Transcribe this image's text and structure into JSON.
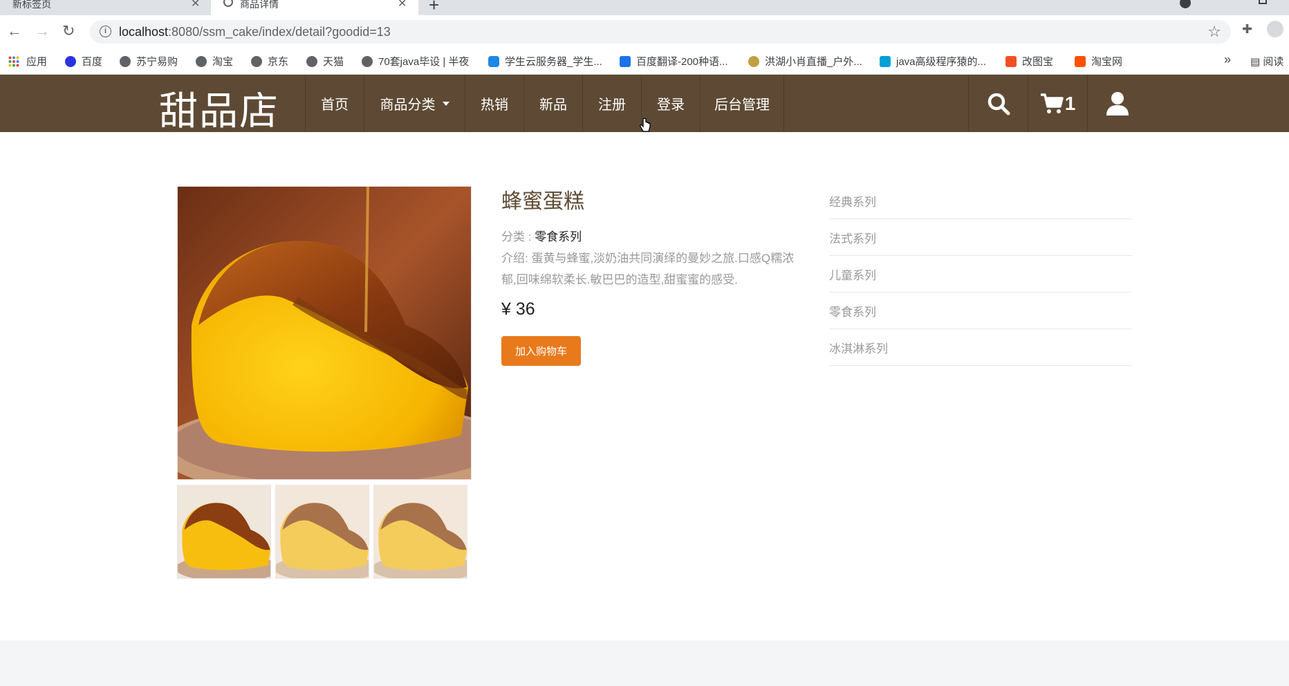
{
  "browser": {
    "tabs": [
      {
        "title": "新标签页",
        "active": false
      },
      {
        "title": "商品详情",
        "active": true
      }
    ],
    "url_host": "localhost",
    "url_rest": ":8080/ssm_cake/index/detail?goodid=13",
    "bookmarks": [
      {
        "label": "应用",
        "icon": "apps-icon"
      },
      {
        "label": "百度",
        "icon": "baidu-icon"
      },
      {
        "label": "苏宁易购",
        "icon": "globe-icon"
      },
      {
        "label": "淘宝",
        "icon": "globe-icon"
      },
      {
        "label": "京东",
        "icon": "globe-icon"
      },
      {
        "label": "天猫",
        "icon": "globe-icon"
      },
      {
        "label": "70套java毕设 | 半夜",
        "icon": "globe-icon"
      },
      {
        "label": "学生云服务器_学生...",
        "icon": "cloud-icon"
      },
      {
        "label": "百度翻译-200种语...",
        "icon": "translate-icon"
      },
      {
        "label": "洪湖小肖直播_户外...",
        "icon": "bird-icon"
      },
      {
        "label": "java高级程序猿的...",
        "icon": "bilibili-icon"
      },
      {
        "label": "改图宝",
        "icon": "gaitubao-icon"
      },
      {
        "label": "淘宝网",
        "icon": "taobao-icon"
      }
    ],
    "more": "»",
    "reading_list": "阅读"
  },
  "site": {
    "logo": "甜品店",
    "nav": [
      "首页",
      "商品分类",
      "热销",
      "新品",
      "注册",
      "登录",
      "后台管理"
    ],
    "cart_count": "1"
  },
  "product": {
    "title": "蜂蜜蛋糕",
    "category_label": "分类 : ",
    "category_value": "零食系列",
    "description": "介绍: 蛋黄与蜂蜜,淡奶油共同演绎的曼妙之旅.口感Q糯浓郁,回味绵软柔长.敏巴巴的造型,甜蜜蜜的感受.",
    "price": "¥ 36",
    "add_to_cart": "加入购物车"
  },
  "categories": [
    "经典系列",
    "法式系列",
    "儿童系列",
    "零食系列",
    "冰淇淋系列"
  ],
  "colors": {
    "header_bg": "#5e4a34",
    "accent_orange": "#e87a1c"
  }
}
